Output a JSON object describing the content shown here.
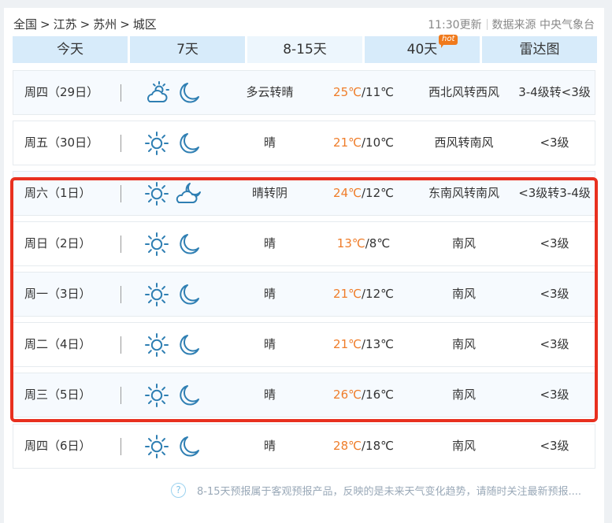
{
  "breadcrumb": {
    "items": [
      "全国",
      "江苏",
      "苏州",
      "城区"
    ],
    "separator": ">"
  },
  "meta": {
    "update_time": "11:30更新",
    "source": "数据来源 中央气象台"
  },
  "tabs": [
    {
      "label": "今天"
    },
    {
      "label": "7天"
    },
    {
      "label": "8-15天",
      "active": true
    },
    {
      "label": "40天",
      "badge": "hot"
    },
    {
      "label": "雷达图"
    }
  ],
  "rows": [
    {
      "day": "周四（29日）",
      "day_icon": "partly-cloudy-icon",
      "night_icon": "moon-icon",
      "condition": "多云转晴",
      "high": "25℃",
      "low": "/11℃",
      "wind": "西北风转西风",
      "level": "3-4级转<3级"
    },
    {
      "day": "周五（30日）",
      "day_icon": "sun-icon",
      "night_icon": "moon-icon",
      "condition": "晴",
      "high": "21℃",
      "low": "/10℃",
      "wind": "西风转南风",
      "level": "<3级"
    },
    {
      "day": "周六（1日）",
      "day_icon": "sun-icon",
      "night_icon": "cloudy-night-icon",
      "condition": "晴转阴",
      "high": "24℃",
      "low": "/12℃",
      "wind": "东南风转南风",
      "level": "<3级转3-4级"
    },
    {
      "day": "周日（2日）",
      "day_icon": "sun-icon",
      "night_icon": "moon-icon",
      "condition": "晴",
      "high": "13℃",
      "low": "/8℃",
      "wind": "南风",
      "level": "<3级"
    },
    {
      "day": "周一（3日）",
      "day_icon": "sun-icon",
      "night_icon": "moon-icon",
      "condition": "晴",
      "high": "21℃",
      "low": "/12℃",
      "wind": "南风",
      "level": "<3级"
    },
    {
      "day": "周二（4日）",
      "day_icon": "sun-icon",
      "night_icon": "moon-icon",
      "condition": "晴",
      "high": "21℃",
      "low": "/13℃",
      "wind": "南风",
      "level": "<3级"
    },
    {
      "day": "周三（5日）",
      "day_icon": "sun-icon",
      "night_icon": "moon-icon",
      "condition": "晴",
      "high": "26℃",
      "low": "/16℃",
      "wind": "南风",
      "level": "<3级"
    },
    {
      "day": "周四（6日）",
      "day_icon": "sun-icon",
      "night_icon": "moon-icon",
      "condition": "晴",
      "high": "28℃",
      "low": "/18℃",
      "wind": "南风",
      "level": "<3级"
    }
  ],
  "footer": {
    "help_icon": "?",
    "text": "8-15天预报属于客观预报产品，反映的是未来天气变化趋势，请随时关注最新预报...."
  },
  "colors": {
    "accent_orange": "#ef7d2a",
    "tab_bg": "#d7ebfa",
    "highlight_red": "#e8301f",
    "icon_blue": "#2f7fb3"
  }
}
